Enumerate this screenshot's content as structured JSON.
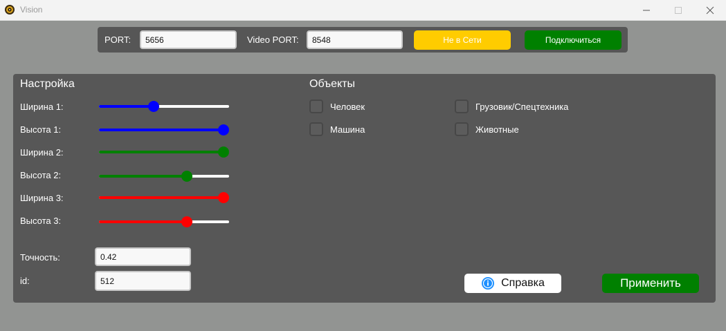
{
  "window": {
    "title": "Vision"
  },
  "connection": {
    "port_label": "PORT:",
    "port_value": "5656",
    "video_port_label": "Video PORT:",
    "video_port_value": "8548",
    "status_label": "Не в Сети",
    "connect_label": "Подключиться"
  },
  "settings": {
    "heading": "Настройка",
    "sliders": [
      {
        "label": "Ширина 1:",
        "value": 0.41,
        "color": "#0000ff"
      },
      {
        "label": "Высота 1:",
        "value": 1.0,
        "color": "#0000ff"
      },
      {
        "label": "Ширина 2:",
        "value": 1.0,
        "color": "#008000"
      },
      {
        "label": "Высота 2:",
        "value": 0.69,
        "color": "#008000"
      },
      {
        "label": "Ширина 3:",
        "value": 1.0,
        "color": "#ff0000"
      },
      {
        "label": "Высота 3:",
        "value": 0.69,
        "color": "#ff0000"
      }
    ],
    "accuracy_label": "Точность:",
    "accuracy_value": "0.42",
    "id_label": "id:",
    "id_value": "512"
  },
  "objects": {
    "heading": "Объекты",
    "items": [
      {
        "label": "Человек",
        "checked": false
      },
      {
        "label": "Грузовик/Спецтехника",
        "checked": false
      },
      {
        "label": "Машина",
        "checked": false
      },
      {
        "label": "Животные",
        "checked": false
      }
    ]
  },
  "actions": {
    "help_label": "Справка",
    "apply_label": "Применить"
  },
  "colors": {
    "background": "#929492",
    "panel": "#575757",
    "status_yellow": "#ffcc00",
    "green": "#008000",
    "help_icon": "#1e90ff"
  }
}
